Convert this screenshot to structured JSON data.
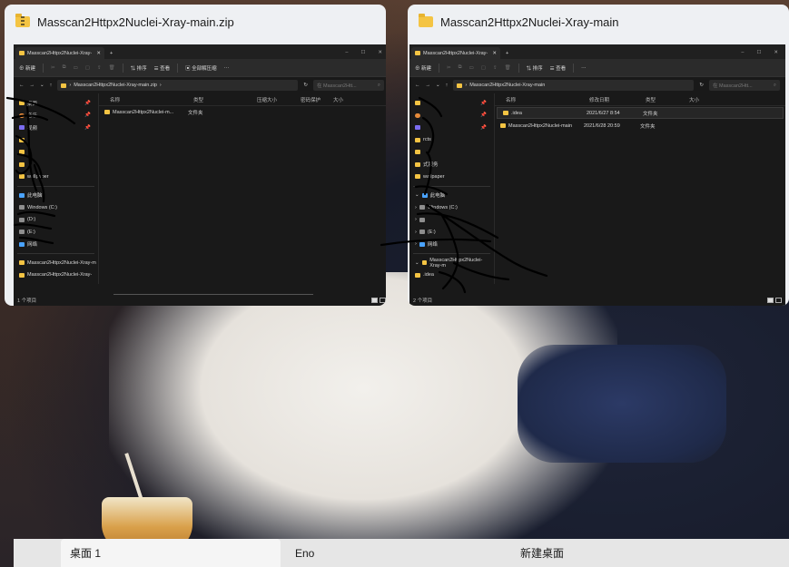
{
  "windows": [
    {
      "title": "Masscan2Httpx2Nuclei-Xray-main.zip",
      "is_zip": true,
      "tab_label": "Masscan2Httpx2Nuclei-Xray-",
      "toolbar": {
        "new": "新建",
        "sort": "排序",
        "view": "查看",
        "extract": "全部解压缩",
        "more": "···"
      },
      "path": "Masscan2Httpx2Nuclei-Xray-main.zip",
      "search_placeholder": "在 Masscan2Htt...",
      "columns": [
        "名称",
        "类型",
        "压缩大小",
        "密码保护",
        "大小"
      ],
      "rows": [
        {
          "name": "Masscan2Httpx2Nuclei-m...",
          "type": "文件夹",
          "extra": ""
        }
      ],
      "nav": [
        "桌面",
        "音乐",
        "视频",
        "",
        "",
        "",
        "wallpaper",
        "此电脑",
        "Windows (C:)",
        "(D:)",
        "(E:)",
        "网络",
        "Masscan2Httpx2Nuclei-Xray-m",
        "Masscan2Httpx2Nuclei-Xray-"
      ],
      "status": "1 个项目"
    },
    {
      "title": "Masscan2Httpx2Nuclei-Xray-main",
      "is_zip": false,
      "tab_label": "Masscan2Httpx2Nuclei-Xray-",
      "toolbar": {
        "new": "新建",
        "sort": "排序",
        "view": "查看",
        "extract": "",
        "more": "···"
      },
      "path": "Masscan2Httpx2Nuclei-Xray-main",
      "search_placeholder": "在 Masscan2Htt...",
      "columns": [
        "名称",
        "修改日期",
        "类型",
        "大小"
      ],
      "rows": [
        {
          "name": ".idea",
          "date": "2021/6/27 8:54",
          "type": "文件夹"
        },
        {
          "name": "Masscan2Httpx2Nuclei-main",
          "date": "2021/6/28 20:59",
          "type": "文件夹"
        }
      ],
      "nav": [
        "",
        "",
        "",
        "rcts",
        "",
        "式服务",
        "wallpaper",
        "此电脑",
        "Windows (C:)",
        "",
        "(E:)",
        "网络",
        "Masscan2Httpx2Nuclei-Xray-m",
        ".idea"
      ],
      "status": "2 个项目"
    }
  ],
  "desktops": {
    "d1": "桌面 1",
    "d2": "Eno",
    "new": "新建桌面"
  },
  "colors": {
    "folder": "#f4c443",
    "explorer_bg": "#191919",
    "accent": "#4aa3ff"
  }
}
